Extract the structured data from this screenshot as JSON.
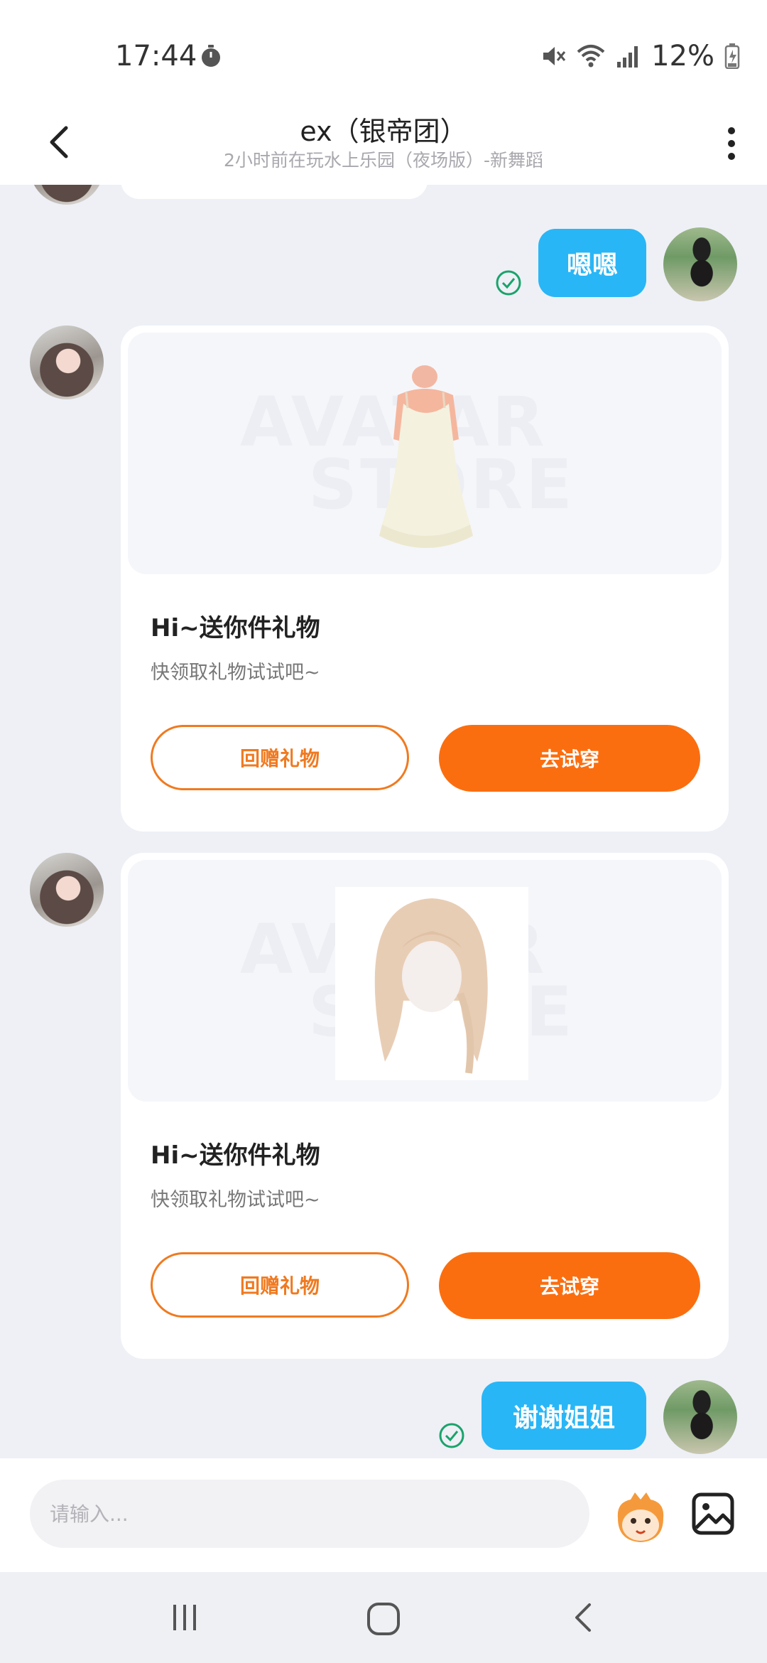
{
  "status_bar": {
    "time": "17:44",
    "battery_percent": "12%"
  },
  "header": {
    "title": "ex（银帝团）",
    "subtitle": "2小时前在玩水上乐园（夜场版）-新舞蹈"
  },
  "messages": [
    {
      "sender": "self",
      "text": "嗯嗯"
    },
    {
      "sender": "self",
      "text": "谢谢姐姐"
    }
  ],
  "gift_cards": [
    {
      "title": "Hi~送你件礼物",
      "description": "快领取礼物试试吧~",
      "secondary_button": "回赠礼物",
      "primary_button": "去试穿",
      "item_icon": "white-dress"
    },
    {
      "title": "Hi~送你件礼物",
      "description": "快领取礼物试试吧~",
      "secondary_button": "回赠礼物",
      "primary_button": "去试穿",
      "item_icon": "blonde-hairstyle"
    }
  ],
  "watermark": {
    "line1": "AVATAR",
    "line2": "STORE"
  },
  "input": {
    "placeholder": "请输入..."
  },
  "colors": {
    "accent": "#fb6e0f",
    "self_bubble": "#29b6f6",
    "background": "#eef0f6"
  }
}
